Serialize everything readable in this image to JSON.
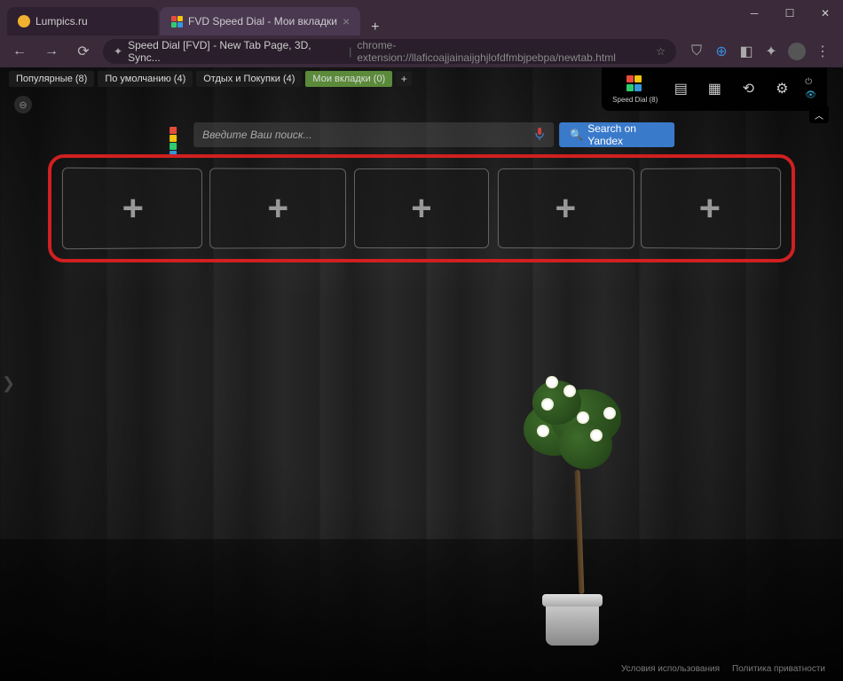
{
  "tabs": {
    "tab1": "Lumpics.ru",
    "tab2": "FVD Speed Dial - Мои вкладки"
  },
  "addressbar": {
    "title": "Speed Dial [FVD] - New Tab Page, 3D, Sync...",
    "url": "chrome-extension://llaficoajjainaijghjlofdfmbjpebpa/newtab.html"
  },
  "categories": {
    "c1": "Популярные (8)",
    "c2": "По умолчанию (4)",
    "c3": "Отдых и Покупки (4)",
    "c4": "Мои вкладки (0)"
  },
  "panel": {
    "label": "Speed Dial (8)"
  },
  "search": {
    "placeholder": "Введите Ваш поиск...",
    "button": "Search on Yandex"
  },
  "footer": {
    "terms": "Условия использования",
    "privacy": "Политика приватности"
  }
}
